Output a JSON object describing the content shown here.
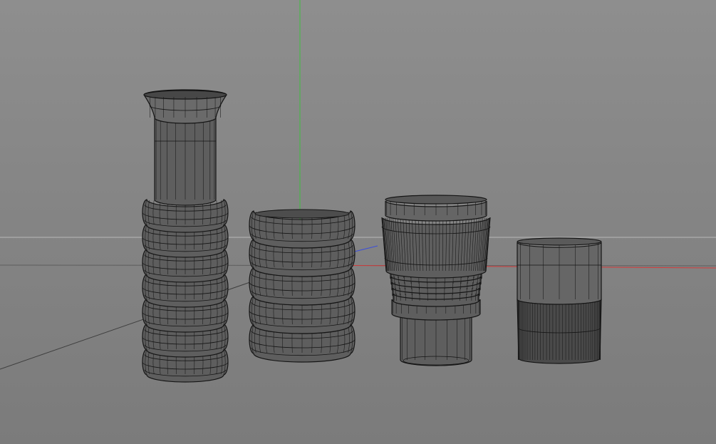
{
  "viewport": {
    "background_top": "#8e8e8e",
    "background_bottom": "#7b7b7b",
    "colors": {
      "horizon_line": "#b9b9b9",
      "grid_line": "#5d5d5d",
      "y_axis": "#3fbf3f",
      "x_axis": "#d23a3a",
      "z_axis": "#3d4fd8",
      "mesh_fill": "#5e5e5e",
      "mesh_shade": "#4a4a4a",
      "mesh_wire": "#151515"
    }
  },
  "objects": [
    {
      "name": "vase-with-bellows",
      "bellows_rings": 7
    },
    {
      "name": "stacked-torus-vase",
      "bellows_rings": 5
    },
    {
      "name": "lens-shaped-cup",
      "knurl_ribs": 48
    },
    {
      "name": "tumbler-glass",
      "knurl_ribs": 40
    }
  ]
}
